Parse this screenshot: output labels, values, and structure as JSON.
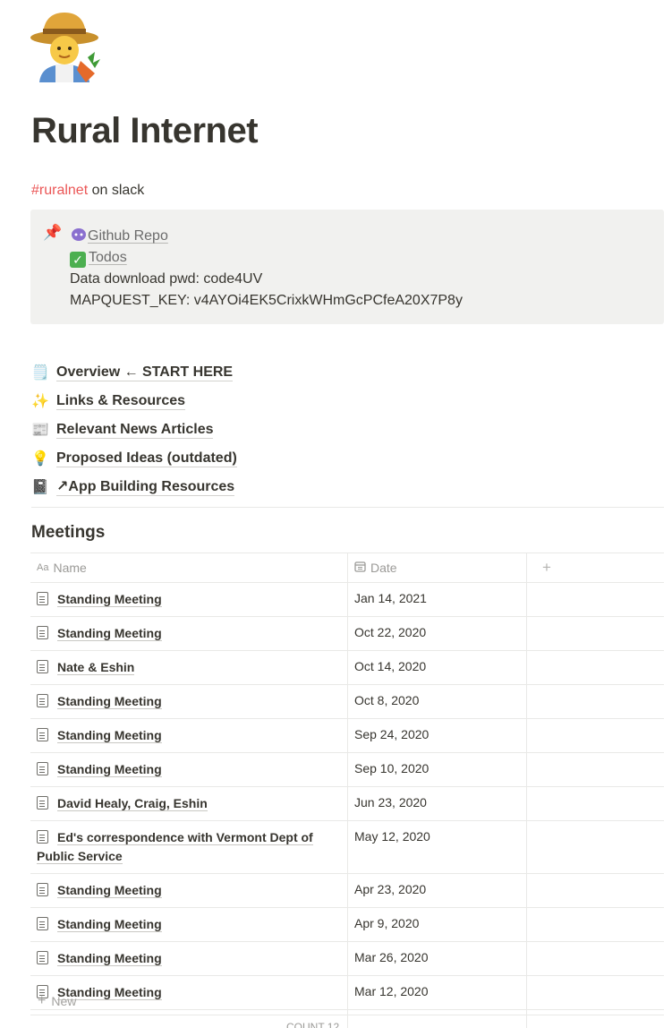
{
  "page": {
    "icon": "farmer-emoji",
    "title": "Rural Internet",
    "slack_tag": "#ruralnet",
    "slack_suffix": " on slack"
  },
  "callout": {
    "pin_icon": "📌",
    "github_label": "Github Repo",
    "todos_label": "Todos",
    "data_pwd": "Data download pwd: code4UV",
    "mapquest_key": "MAPQUEST_KEY: v4AYOi4EK5CrixkWHmGcPCfeA20X7P8y"
  },
  "links": [
    {
      "icon": "🗒️",
      "label": "Overview ← START HERE"
    },
    {
      "icon": "✨",
      "label": "Links & Resources"
    },
    {
      "icon": "📰",
      "label": "Relevant News Articles"
    },
    {
      "icon": "💡",
      "label": "Proposed Ideas (outdated)"
    },
    {
      "icon": "📓",
      "label": "↗App Building Resources"
    }
  ],
  "meetings": {
    "title": "Meetings",
    "columns": {
      "name": "Name",
      "date": "Date",
      "name_icon": "Aa"
    },
    "rows": [
      {
        "name": "Standing Meeting",
        "date": "Jan 14, 2021"
      },
      {
        "name": "Standing Meeting",
        "date": "Oct 22, 2020"
      },
      {
        "name": "Nate & Eshin",
        "date": "Oct 14, 2020"
      },
      {
        "name": "Standing Meeting",
        "date": "Oct 8, 2020"
      },
      {
        "name": "Standing Meeting",
        "date": "Sep 24, 2020"
      },
      {
        "name": "Standing Meeting",
        "date": "Sep 10, 2020"
      },
      {
        "name": "David Healy, Craig, Eshin",
        "date": "Jun 23, 2020"
      },
      {
        "name": "Ed's correspondence with Vermont Dept of Public Service",
        "date": "May 12, 2020"
      },
      {
        "name": "Standing Meeting",
        "date": "Apr 23, 2020"
      },
      {
        "name": "Standing Meeting",
        "date": "Apr 9, 2020"
      },
      {
        "name": "Standing Meeting",
        "date": "Mar 26, 2020"
      },
      {
        "name": "Standing Meeting",
        "date": "Mar 12, 2020"
      }
    ],
    "new_label": "New",
    "count_label": "COUNT 12"
  }
}
